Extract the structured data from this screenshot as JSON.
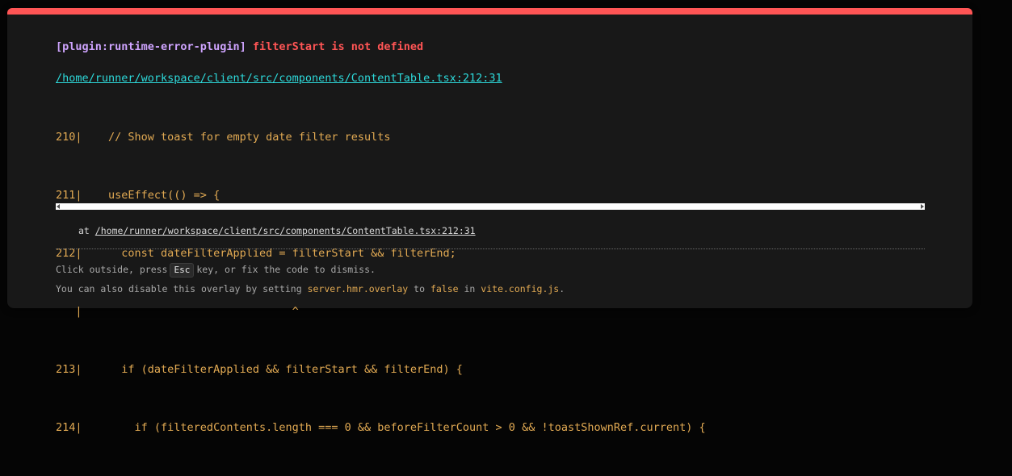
{
  "overlay": {
    "accent_color": "#ff5555",
    "plugin_tag": "[plugin:runtime-error-plugin]",
    "error_message": "filterStart is not defined",
    "file_link": "/home/runner/workspace/client/src/components/ContentTable.tsx:212:31",
    "code_frame": [
      "210|    // Show toast for empty date filter results",
      "211|    useEffect(() => {",
      "212|      const dateFilterApplied = filterStart && filterEnd;",
      "   |                                ^",
      "213|      if (dateFilterApplied && filterStart && filterEnd) {",
      "214|        if (filteredContents.length === 0 && beforeFilterCount > 0 && !toastShownRef.current) {"
    ],
    "stack_prefix": "at",
    "stack_location": "/home/runner/workspace/client/src/components/ContentTable.tsx:212:31",
    "tip": {
      "line1_before": "Click outside, press",
      "esc_key": "Esc",
      "line1_after": "key, or fix the code to dismiss.",
      "line2_before": "You can also disable this overlay by setting",
      "config_option": "server.hmr.overlay",
      "line2_to": "to",
      "false_value": "false",
      "line2_in": "in",
      "config_file": "vite.config.js",
      "line2_end": "."
    }
  }
}
